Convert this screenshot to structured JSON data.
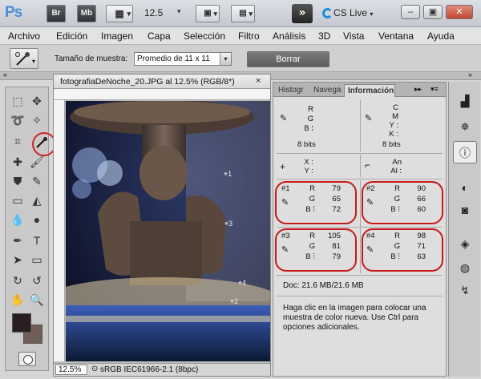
{
  "app": {
    "logo": "Ps",
    "bridge_label": "Br",
    "minibridge_label": "Mb",
    "zoom": "12.5",
    "cslive_label": "CS Live",
    "workspace_icon": "double-chevron-right-icon"
  },
  "menu": [
    "Archivo",
    "Edición",
    "Imagen",
    "Capa",
    "Selección",
    "Filtro",
    "Análisis",
    "3D",
    "Vista",
    "Ventana",
    "Ayuda"
  ],
  "options": {
    "sample_size_label": "Tamaño de muestra:",
    "sample_size_value": "Promedio de 11 x 11",
    "clear_label": "Borrar"
  },
  "document": {
    "title": "fotografiaDeNoche_20.JPG al 12.5% (RGB/8*)",
    "close": "×",
    "zoom_field": "12.5%",
    "status_profile": "sRGB IEC61966-2.1 (8bpc)"
  },
  "panel": {
    "tabs": [
      "Histogr",
      "Navega",
      "Información"
    ],
    "active_tab": "Información",
    "rgb_labels": [
      "R :",
      "G :",
      "B :"
    ],
    "cmyk_labels": [
      "C :",
      "M :",
      "Y :",
      "K :"
    ],
    "bits_left": "8 bits",
    "bits_right": "8 bits",
    "xy_labels": [
      "X :",
      "Y :"
    ],
    "size_labels": [
      "An :",
      "Al :"
    ],
    "samplers": [
      {
        "id": "#1",
        "R": "79",
        "G": "65",
        "B": "72"
      },
      {
        "id": "#2",
        "R": "90",
        "G": "66",
        "B": "60"
      },
      {
        "id": "#3",
        "R": "105",
        "G": "81",
        "B": "79"
      },
      {
        "id": "#4",
        "R": "98",
        "G": "71",
        "B": "63"
      }
    ],
    "doc_size": "Doc: 21.6 MB/21.6 MB",
    "help": "Haga clic en la imagen para colocar una muestra de color nueva. Use Ctrl para opciones adicionales."
  },
  "canvas_markers": [
    "1",
    "2",
    "3",
    "4"
  ],
  "colors": {
    "foreground": "#2a1e20",
    "background": "#6e5e55",
    "annotation": "#c81818"
  }
}
